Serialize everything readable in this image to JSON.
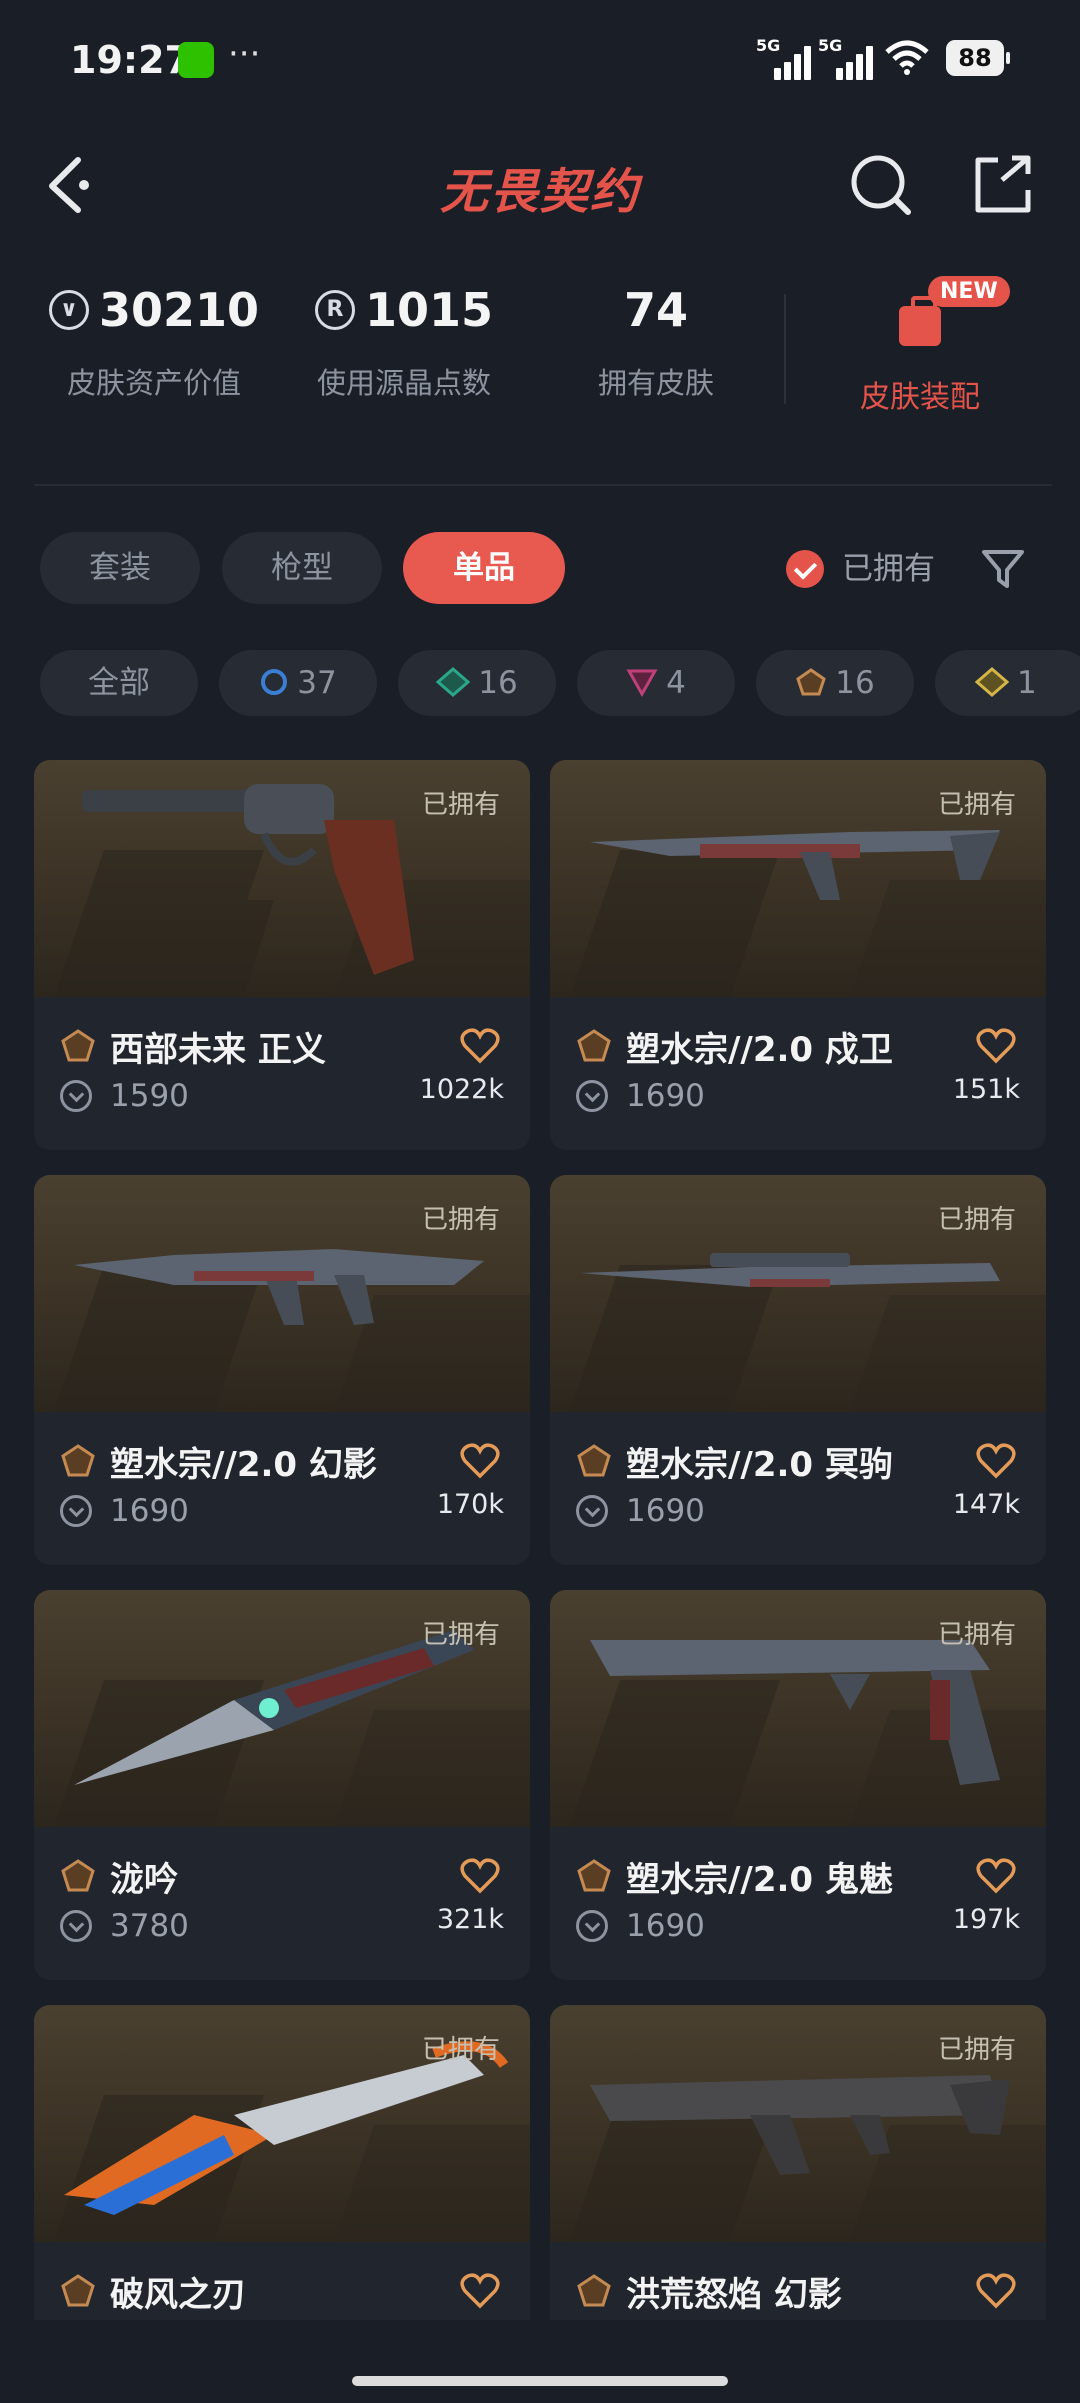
{
  "status_bar": {
    "time": "19:27",
    "dots": "···",
    "signal1": "5G",
    "signal2": "5G",
    "battery": "88"
  },
  "header": {
    "title": "无畏契约"
  },
  "stats": {
    "asset_value": {
      "value": "30210",
      "label": "皮肤资产价值",
      "icon": "vp-icon"
    },
    "radianite": {
      "value": "1015",
      "label": "使用源晶点数",
      "icon": "R"
    },
    "skins_owned": {
      "value": "74",
      "label": "拥有皮肤"
    },
    "outfit": {
      "label": "皮肤装配",
      "badge": "NEW"
    }
  },
  "filters": {
    "tabs": [
      "套装",
      "枪型",
      "单品"
    ],
    "active_tab": "单品",
    "owned_toggle": "已拥有"
  },
  "tiers": [
    {
      "label": "全部"
    },
    {
      "count": "37",
      "color": "#3b7fd4",
      "shape": "circle"
    },
    {
      "count": "16",
      "color": "#2aa88c",
      "shape": "diamond"
    },
    {
      "count": "4",
      "color": "#c0407a",
      "shape": "triangle"
    },
    {
      "count": "16",
      "color": "#c48a52",
      "shape": "pentagon"
    },
    {
      "count": "1",
      "color": "#d4b545",
      "shape": "diamond"
    }
  ],
  "items": [
    {
      "name": "西部未来 正义",
      "price": "1590",
      "likes": "1022k",
      "owned": "已拥有",
      "weapon": "revolver"
    },
    {
      "name": "塑水宗//2.0 戍卫",
      "price": "1690",
      "likes": "151k",
      "owned": "已拥有",
      "weapon": "rifle"
    },
    {
      "name": "塑水宗//2.0 幻影",
      "price": "1690",
      "likes": "170k",
      "owned": "已拥有",
      "weapon": "smg"
    },
    {
      "name": "塑水宗//2.0 冥驹",
      "price": "1690",
      "likes": "147k",
      "owned": "已拥有",
      "weapon": "sniper"
    },
    {
      "name": "泷吟",
      "price": "3780",
      "likes": "321k",
      "owned": "已拥有",
      "weapon": "knife"
    },
    {
      "name": "塑水宗//2.0 鬼魅",
      "price": "1690",
      "likes": "197k",
      "owned": "已拥有",
      "weapon": "pistol"
    },
    {
      "name": "破风之刃",
      "price": "",
      "likes": "",
      "owned": "已拥有",
      "weapon": "blade"
    },
    {
      "name": "洪荒怒焰 幻影",
      "price": "",
      "likes": "",
      "owned": "已拥有",
      "weapon": "assault"
    }
  ],
  "colors": {
    "accent": "#e5544b",
    "background": "#1a1e26",
    "card": "#20252e"
  }
}
